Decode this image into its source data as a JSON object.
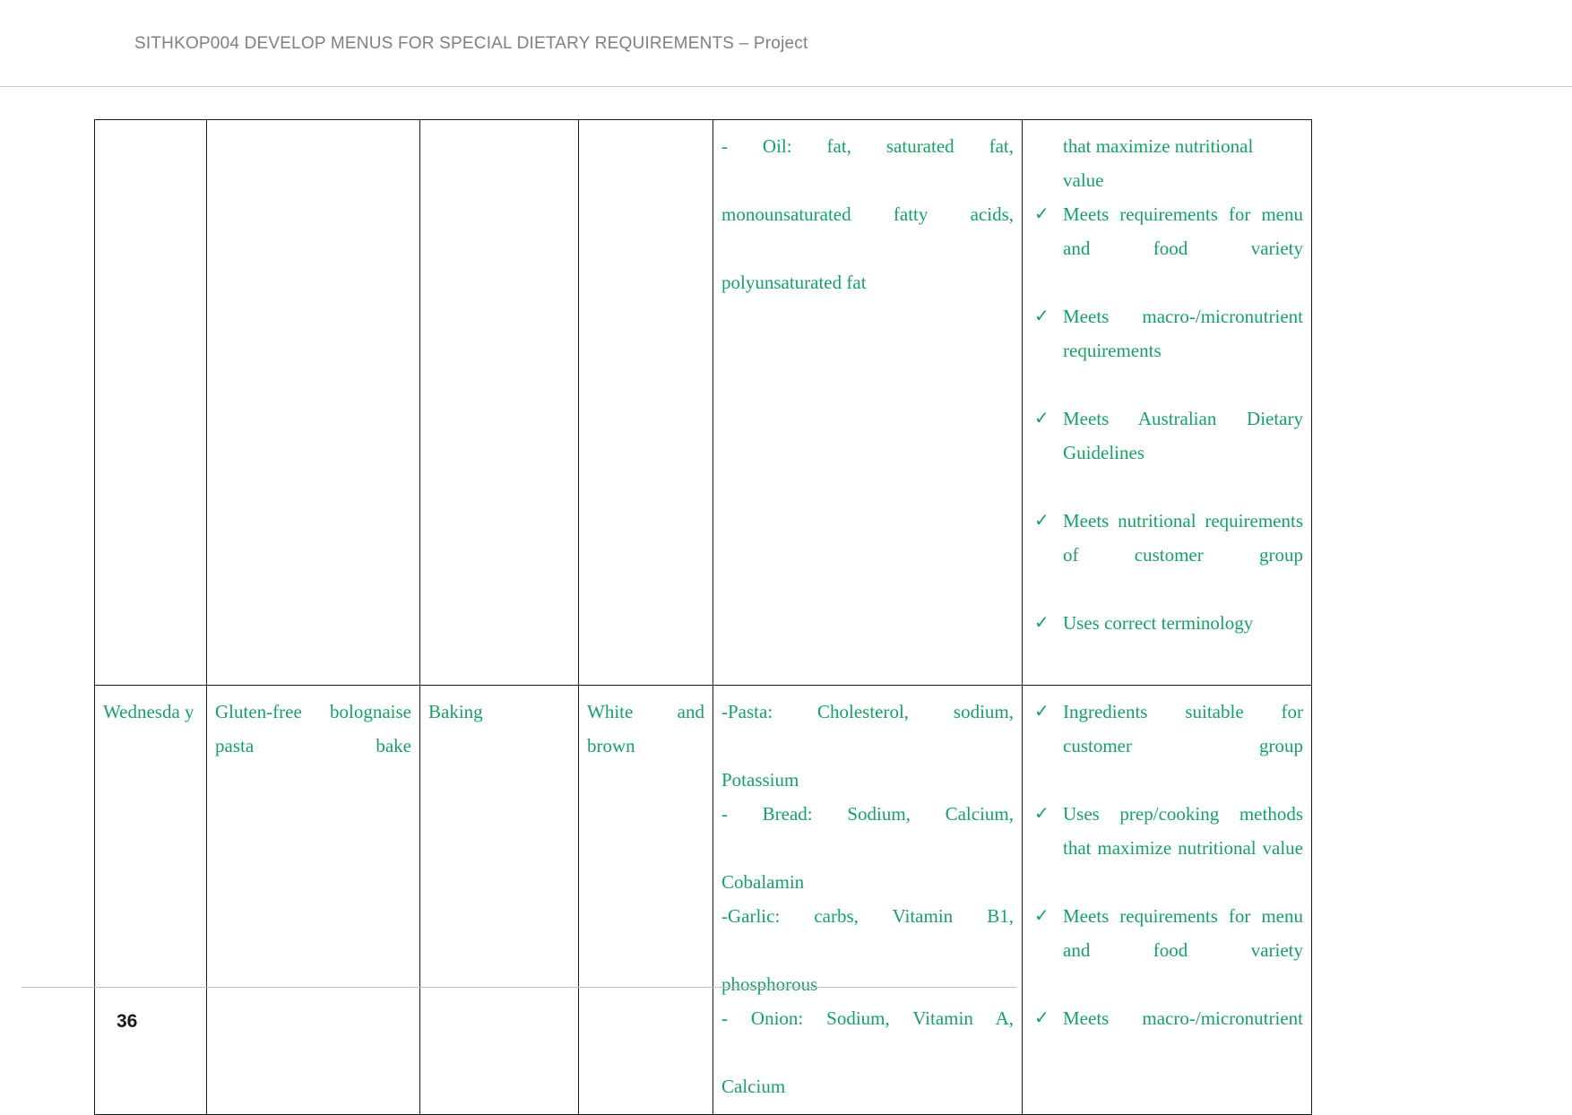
{
  "header": {
    "title": "SITHKOP004 DEVELOP MENUS FOR SPECIAL DIETARY REQUIREMENTS – Project"
  },
  "footer": {
    "page_number": "36"
  },
  "colors": {
    "text_green": "#16a163",
    "header_gray": "#808080",
    "table_border": "#1a1a1a"
  },
  "icons": {
    "check": "✓"
  },
  "table": {
    "rows": [
      {
        "day": "",
        "dish": "",
        "method": "",
        "bread": "",
        "nutrients": {
          "lines": [
            "-     Oil:     fat,     saturated     fat,",
            "monounsaturated          fatty          acids,",
            "polyunsaturated fat"
          ]
        },
        "checks": {
          "continuation": [
            "that     maximize     nutritional",
            "value"
          ],
          "items": [
            "Meets requirements for menu and food variety",
            "Meets   macro-/micronutrient requirements",
            "Meets   Australian   Dietary Guidelines",
            "Meets                     nutritional requirements   of   customer group",
            "Uses correct terminology"
          ]
        }
      },
      {
        "day": "Wednesda y",
        "dish": "Gluten-free   bolognaise pasta bake",
        "method": "Baking",
        "bread": "White          and brown",
        "nutrients": {
          "lines": [
            "-Pasta:       Cholesterol,       sodium,",
            "Potassium",
            "-       Bread:       Sodium,       Calcium,",
            "Cobalamin",
            "-Garlic:       carbs,       Vitamin       B1,",
            "phosphorous",
            "-   Onion:   Sodium,   Vitamin   A,",
            "Calcium"
          ]
        },
        "checks": {
          "continuation": [],
          "items": [
            "Ingredients     suitable     for customer group",
            "Uses   prep/cooking   methods that     maximize     nutritional value",
            "Meets requirements for menu and food variety",
            "Meets   macro-/micronutrient"
          ]
        }
      }
    ]
  }
}
